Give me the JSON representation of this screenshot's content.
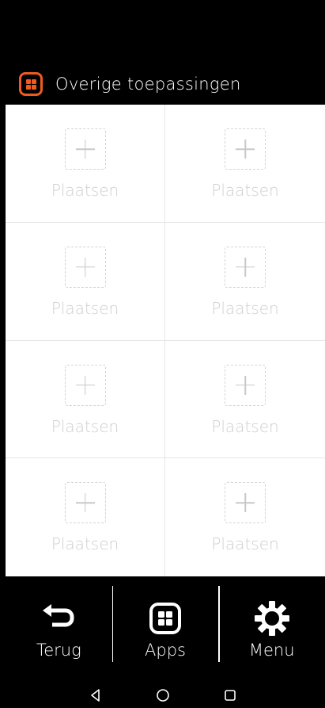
{
  "header": {
    "icon": "apps-grid-icon",
    "accent_color": "#f05a1e",
    "title": "Overige toepassingen"
  },
  "tiles": [
    {
      "label": "Plaatsen",
      "icon": "plus-icon"
    },
    {
      "label": "Plaatsen",
      "icon": "plus-icon"
    },
    {
      "label": "Plaatsen",
      "icon": "plus-icon"
    },
    {
      "label": "Plaatsen",
      "icon": "plus-icon"
    },
    {
      "label": "Plaatsen",
      "icon": "plus-icon"
    },
    {
      "label": "Plaatsen",
      "icon": "plus-icon"
    },
    {
      "label": "Plaatsen",
      "icon": "plus-icon"
    },
    {
      "label": "Plaatsen",
      "icon": "plus-icon"
    }
  ],
  "bottom_nav": {
    "back": {
      "label": "Terug",
      "icon": "back-arrow-icon"
    },
    "apps": {
      "label": "Apps",
      "icon": "apps-grid-icon"
    },
    "menu": {
      "label": "Menu",
      "icon": "gear-icon"
    }
  },
  "system_nav": {
    "back": "triangle-back-icon",
    "home": "circle-home-icon",
    "recents": "square-recents-icon"
  }
}
